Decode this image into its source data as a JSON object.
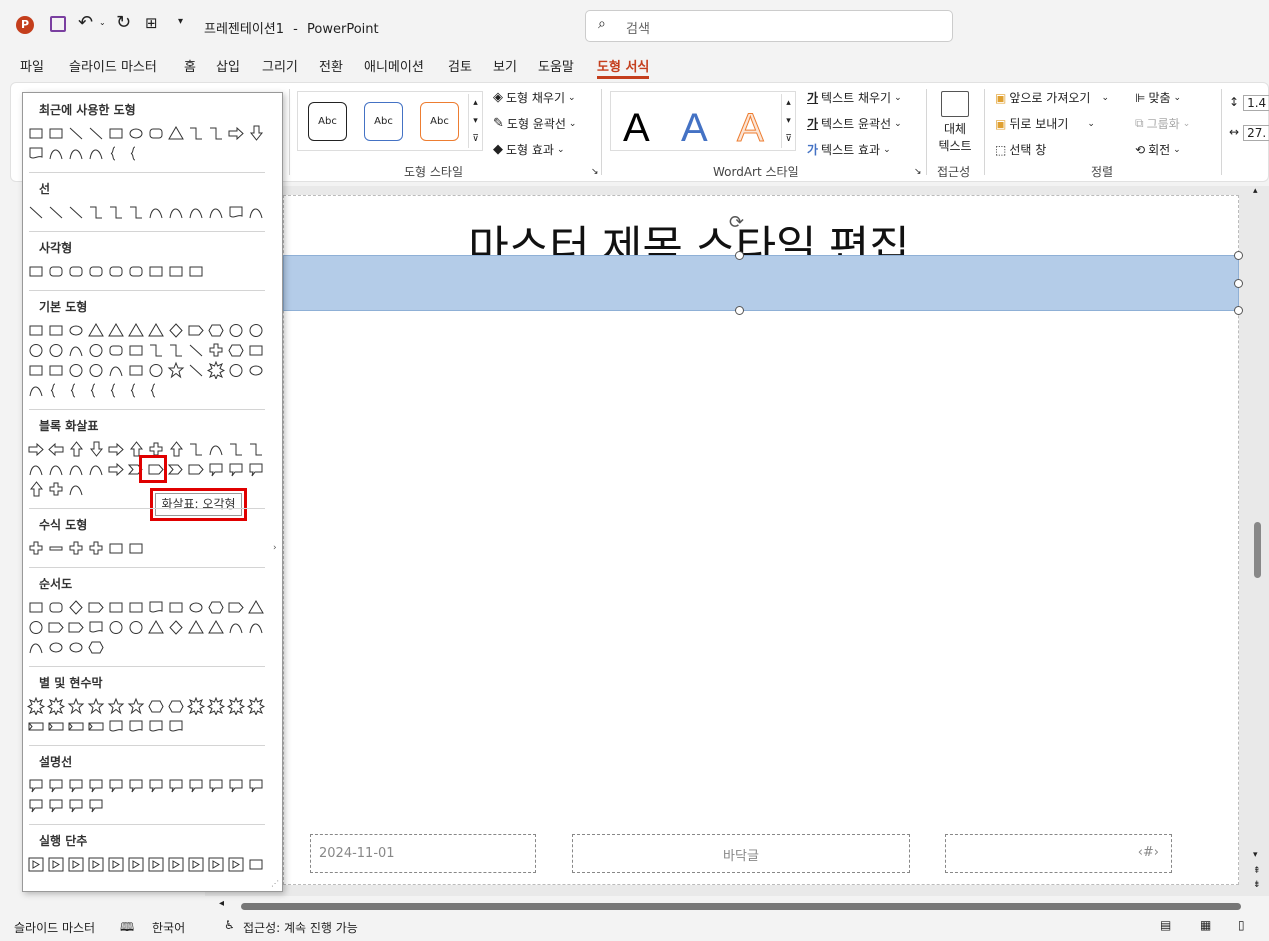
{
  "app": {
    "title": "프레젠테이션1",
    "separator": "-",
    "name": "PowerPoint"
  },
  "search": {
    "placeholder": "검색"
  },
  "menu": [
    "파일",
    "슬라이드 마스터",
    "홈",
    "삽입",
    "그리기",
    "전환",
    "애니메이션",
    "검토",
    "보기",
    "도움말",
    "도형 서식"
  ],
  "ribbon": {
    "shape_styles": {
      "swatch_label": "Abc",
      "fill": "도형 채우기",
      "outline": "도형 윤곽선",
      "effect": "도형 효과",
      "group": "도형 스타일"
    },
    "wordart": {
      "letter": "A",
      "fill": "텍스트 채우기",
      "outline": "텍스트 윤곽선",
      "effect": "텍스트 효과",
      "group": "WordArt 스타일"
    },
    "accessibility": {
      "alt_line1": "대체",
      "alt_line2": "텍스트",
      "group": "접근성"
    },
    "arrange": {
      "bring_forward": "앞으로 가져오기",
      "send_backward": "뒤로 보내기",
      "selection_pane": "선택 창",
      "align": "맞춤",
      "group_btn": "그룹화",
      "rotate": "회전",
      "group": "정렬"
    },
    "size": {
      "height": "1.4",
      "width": "27."
    }
  },
  "slide": {
    "title": "마스터 제목 스타일 편집",
    "date": "2024-11-01",
    "footer": "바닥글",
    "page": "‹#›"
  },
  "panel": {
    "categories": [
      "최근에 사용한 도형",
      "선",
      "사각형",
      "기본 도형",
      "블록 화살표",
      "수식 도형",
      "순서도",
      "별 및 현수막",
      "설명선",
      "실행 단추"
    ],
    "tooltip": "화살표: 오각형"
  },
  "status": {
    "view": "슬라이드 마스터",
    "language": "한국어",
    "accessibility": "접근성: 계속 진행 가능"
  },
  "colors": {
    "accent": "#c43e1c",
    "highlight": "#e00000",
    "selection": "#b4cce8"
  }
}
